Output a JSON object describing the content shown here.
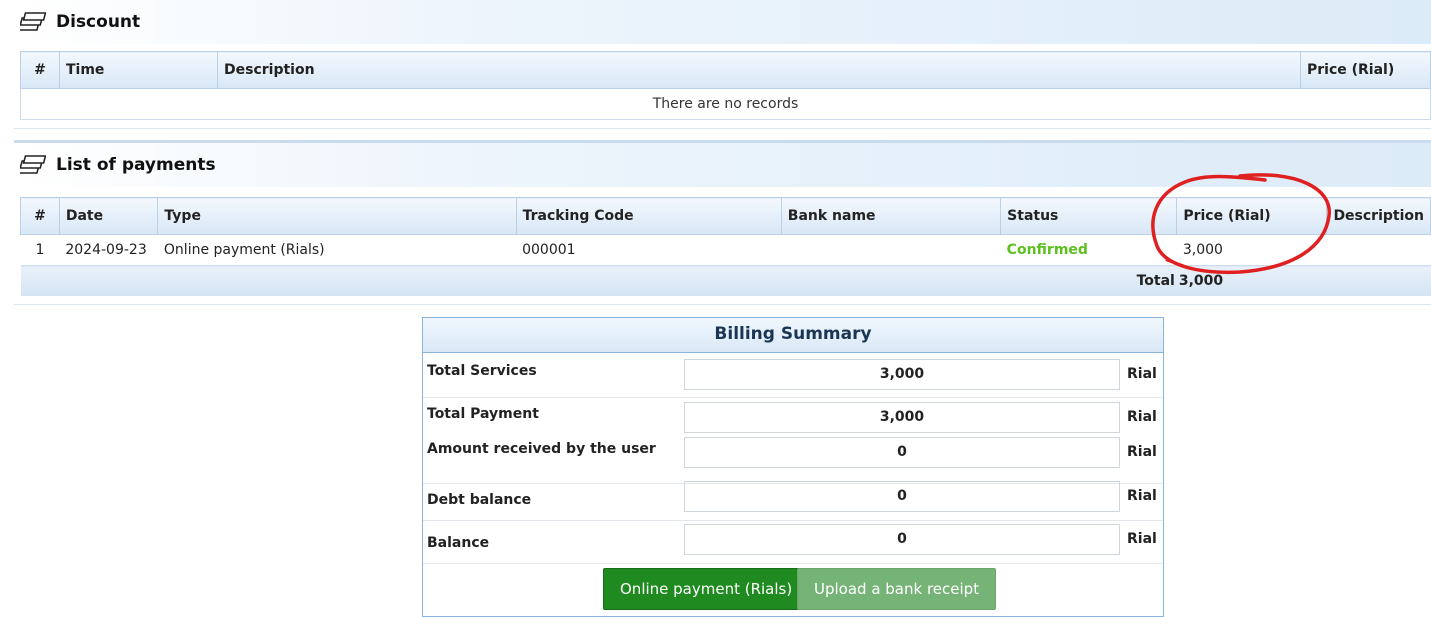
{
  "discount": {
    "title": "Discount",
    "columns": [
      "#",
      "Time",
      "Description",
      "Price (Rial)"
    ],
    "empty_message": "There are no records"
  },
  "payments": {
    "title": "List of payments",
    "columns": [
      "#",
      "Date",
      "Type",
      "Tracking Code",
      "Bank name",
      "Status",
      "Price (Rial)",
      "Description"
    ],
    "rows": [
      {
        "num": "1",
        "date": "2024-09-23",
        "type": "Online payment (Rials)",
        "tracking": "000001",
        "bank": "",
        "status": "Confirmed",
        "price": "3,000",
        "description": ""
      }
    ],
    "total_label": "Total",
    "total_value": "3,000"
  },
  "billing": {
    "title": "Billing Summary",
    "unit": "Rial",
    "rows": [
      {
        "label": "Total Services",
        "value": "3,000"
      },
      {
        "label": "Total Payment",
        "value": "3,000"
      },
      {
        "label": "Amount received by the user",
        "value": "0"
      },
      {
        "label": "Debt balance",
        "value": "0"
      },
      {
        "label": "Balance",
        "value": "0"
      }
    ],
    "online_button": "Online payment (Rials)",
    "upload_button": "Upload a bank receipt"
  },
  "colors": {
    "status_confirmed": "#5cc020",
    "primary_button": "#1f8a1f",
    "secondary_button": "#76b376",
    "annotation": "#e02020"
  }
}
